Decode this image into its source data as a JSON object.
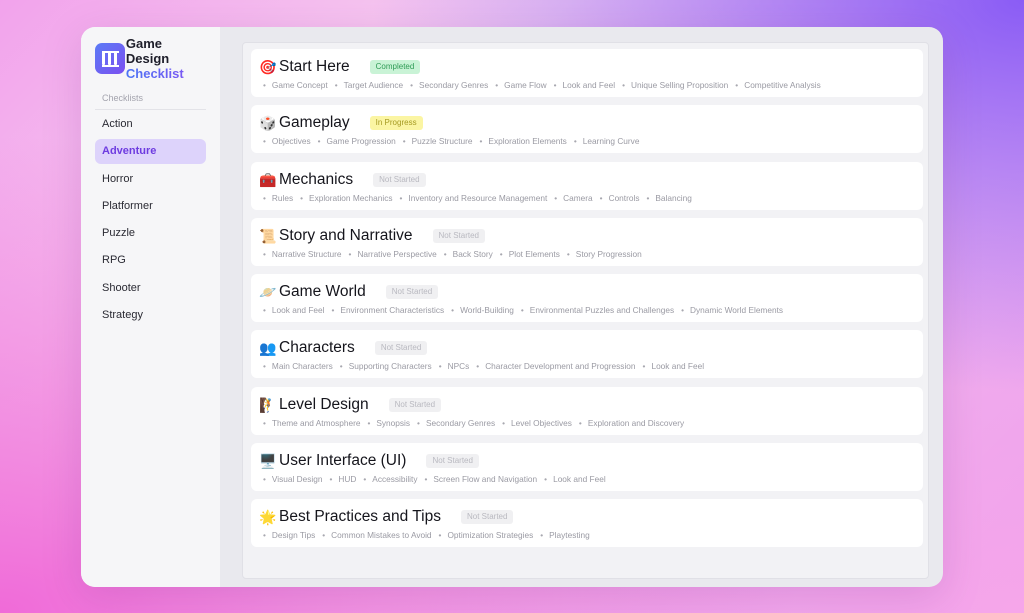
{
  "app": {
    "title_line1": "Game Design",
    "title_line2": "Checklist"
  },
  "sidebar": {
    "section_label": "Checklists",
    "items": [
      {
        "label": "Action",
        "active": false
      },
      {
        "label": "Adventure",
        "active": true
      },
      {
        "label": "Horror",
        "active": false
      },
      {
        "label": "Platformer",
        "active": false
      },
      {
        "label": "Puzzle",
        "active": false
      },
      {
        "label": "RPG",
        "active": false
      },
      {
        "label": "Shooter",
        "active": false
      },
      {
        "label": "Strategy",
        "active": false
      }
    ]
  },
  "sections": [
    {
      "icon": "🎯",
      "icon_name": "target-icon",
      "title": "Start Here",
      "status": "Completed",
      "status_type": "completed",
      "topics": [
        "Game Concept",
        "Target Audience",
        "Secondary Genres",
        "Game Flow",
        "Look and Feel",
        "Unique Selling Proposition",
        "Competitive Analysis"
      ]
    },
    {
      "icon": "🎲",
      "icon_name": "dice-icon",
      "title": "Gameplay",
      "status": "In Progress",
      "status_type": "progress",
      "topics": [
        "Objectives",
        "Game Progression",
        "Puzzle Structure",
        "Exploration Elements",
        "Learning Curve"
      ]
    },
    {
      "icon": "🧰",
      "icon_name": "toolbox-icon",
      "title": "Mechanics",
      "status": "Not Started",
      "status_type": "none",
      "topics": [
        "Rules",
        "Exploration Mechanics",
        "Inventory and Resource Management",
        "Camera",
        "Controls",
        "Balancing"
      ]
    },
    {
      "icon": "📜",
      "icon_name": "scroll-icon",
      "title": "Story and Narrative",
      "status": "Not Started",
      "status_type": "none",
      "topics": [
        "Narrative Structure",
        "Narrative Perspective",
        "Back Story",
        "Plot Elements",
        "Story Progression"
      ]
    },
    {
      "icon": "🪐",
      "icon_name": "planet-icon",
      "title": "Game World",
      "status": "Not Started",
      "status_type": "none",
      "topics": [
        "Look and Feel",
        "Environment Characteristics",
        "World-Building",
        "Environmental Puzzles and Challenges",
        "Dynamic World Elements"
      ]
    },
    {
      "icon": "👥",
      "icon_name": "people-icon",
      "title": "Characters",
      "status": "Not Started",
      "status_type": "none",
      "topics": [
        "Main Characters",
        "Supporting Characters",
        "NPCs",
        "Character Development and Progression",
        "Look and Feel"
      ]
    },
    {
      "icon": "🧗",
      "icon_name": "climber-icon",
      "title": "Level Design",
      "status": "Not Started",
      "status_type": "none",
      "topics": [
        "Theme and Atmosphere",
        "Synopsis",
        "Secondary Genres",
        "Level Objectives",
        "Exploration and Discovery"
      ]
    },
    {
      "icon": "🖥️",
      "icon_name": "monitor-icon",
      "title": "User Interface (UI)",
      "status": "Not Started",
      "status_type": "none",
      "topics": [
        "Visual Design",
        "HUD",
        "Accessibility",
        "Screen Flow and Navigation",
        "Look and Feel"
      ]
    },
    {
      "icon": "🌟",
      "icon_name": "star-icon",
      "title": "Best Practices and Tips",
      "status": "Not Started",
      "status_type": "none",
      "topics": [
        "Design Tips",
        "Common Mistakes to Avoid",
        "Optimization Strategies",
        "Playtesting"
      ]
    }
  ]
}
